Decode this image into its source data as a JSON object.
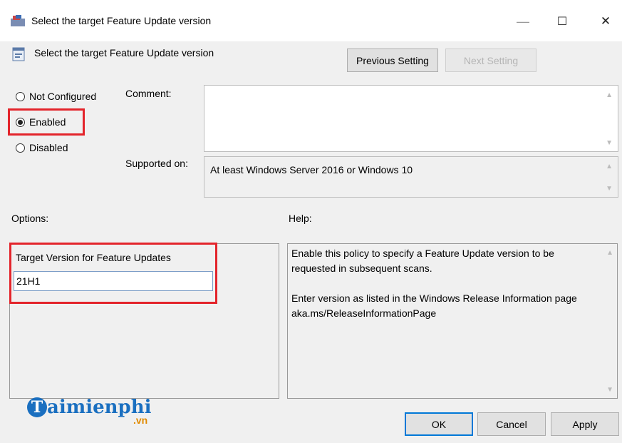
{
  "window": {
    "title": "Select the target Feature Update version",
    "minimize_label": "—",
    "maximize_label": "☐",
    "close_label": "✕"
  },
  "header": {
    "title": "Select the target Feature Update version",
    "previous_setting": "Previous Setting",
    "next_setting": "Next Setting"
  },
  "state": {
    "options": [
      "Not Configured",
      "Enabled",
      "Disabled"
    ],
    "selected": "Enabled"
  },
  "comment": {
    "label": "Comment:",
    "value": ""
  },
  "supported": {
    "label": "Supported on:",
    "value": "At least Windows Server 2016 or Windows 10"
  },
  "options_panel": {
    "label": "Options:",
    "field_label": "Target Version for Feature Updates",
    "field_value": "21H1"
  },
  "help_panel": {
    "label": "Help:",
    "text": "Enable this policy to specify a Feature Update version to be\nrequested in subsequent scans.\n\nEnter version as listed in the Windows Release Information page\naka.ms/ReleaseInformationPage"
  },
  "footer": {
    "ok": "OK",
    "cancel": "Cancel",
    "apply": "Apply"
  },
  "watermark": {
    "letter": "T",
    "name": "aimienphi",
    "domain": ".vn"
  },
  "colors": {
    "highlight": "#e3242b",
    "accent": "#0078d7",
    "logo": "#1a6fc0"
  }
}
